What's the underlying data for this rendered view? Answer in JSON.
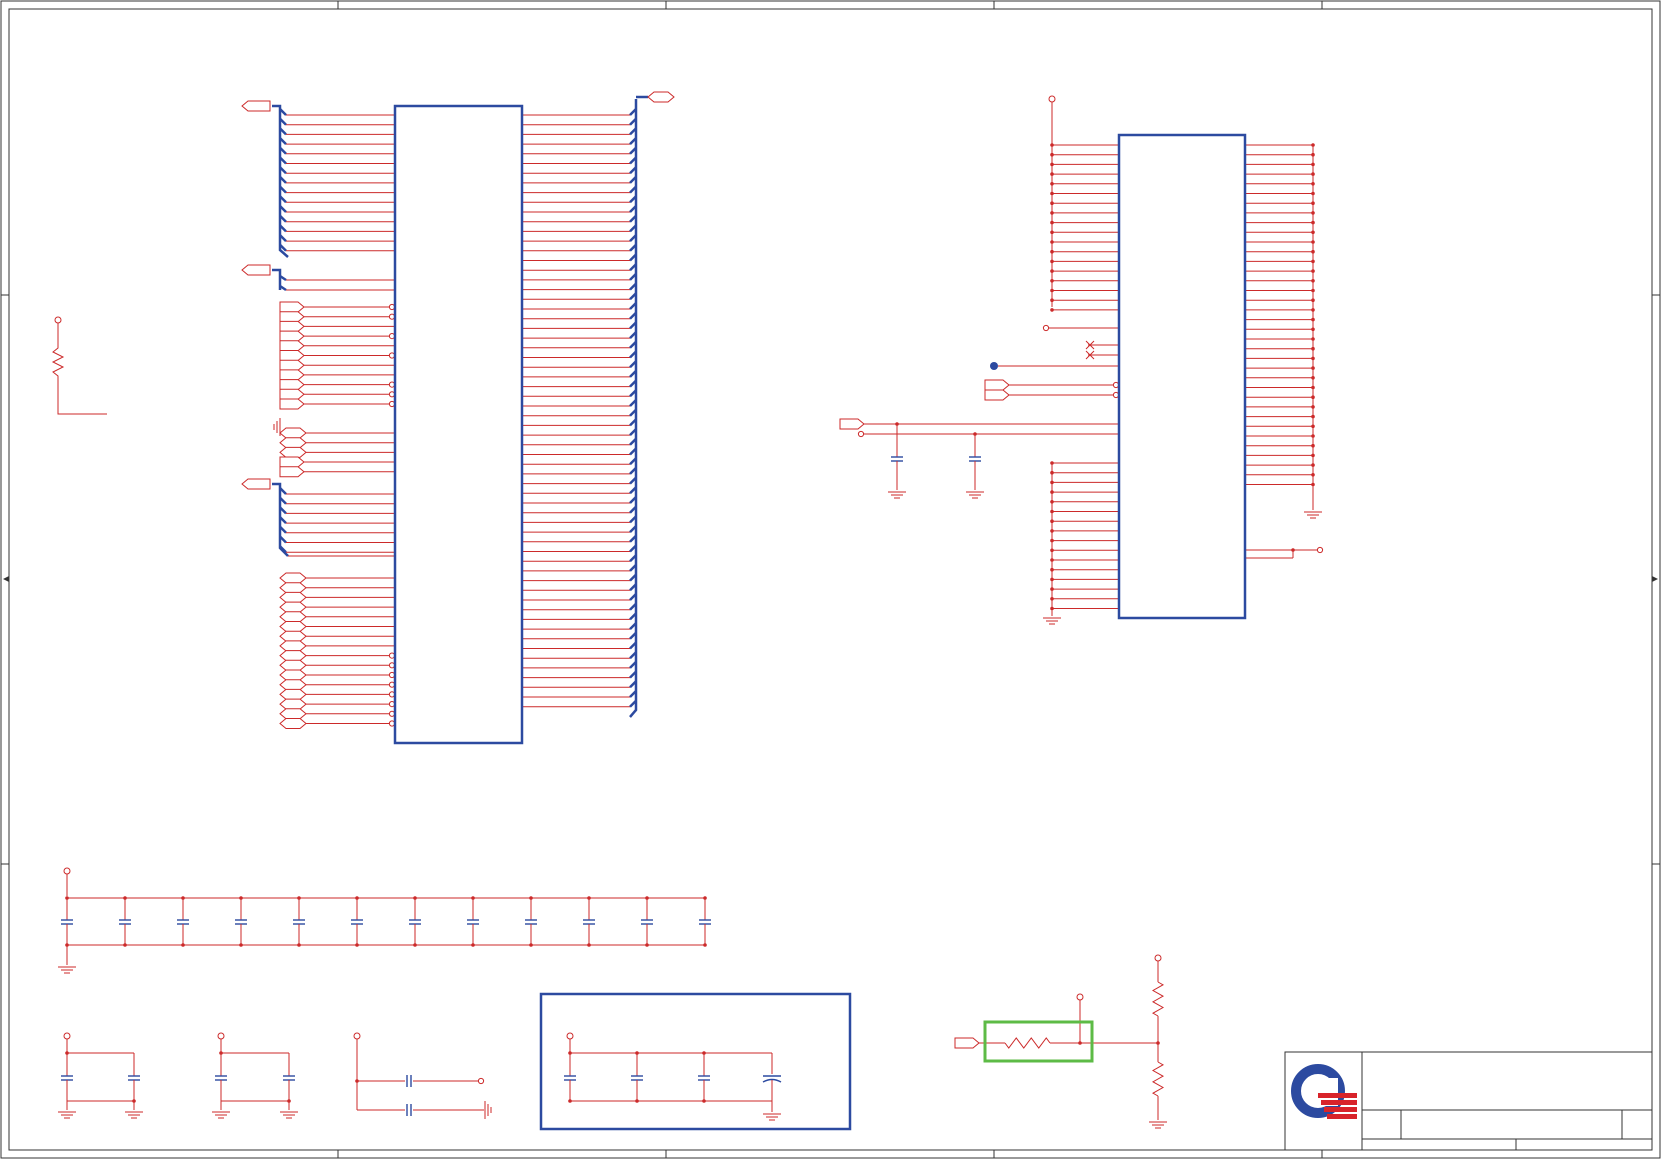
{
  "colors": {
    "wire": "#cc2a2a",
    "bus": "#2c4aa0",
    "component_outline": "#2c4aa0",
    "highlight_box": "#5dbb46",
    "logo_blue": "#2c4aa0",
    "logo_red": "#d8232a"
  },
  "icons": [
    "ground-symbol",
    "power-port",
    "capacitor",
    "resistor",
    "off-sheet-connector",
    "no-connect-mark",
    "company-logo"
  ]
}
